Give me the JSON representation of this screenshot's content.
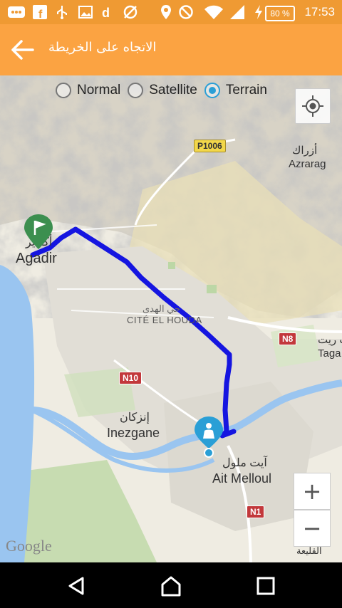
{
  "status_bar": {
    "battery": "80 %",
    "time": "17:53",
    "icons": [
      "messages-icon",
      "facebook-icon",
      "usb-icon",
      "image-icon",
      "d-app-icon",
      "no-sync-icon",
      "location-icon",
      "blocked-icon",
      "wifi-icon",
      "signal-icon",
      "charging-icon"
    ]
  },
  "app_bar": {
    "title": "الاتجاه على الخريطة",
    "back_icon": "arrow-back-icon"
  },
  "map_type": {
    "options": [
      "Normal",
      "Satellite",
      "Terrain"
    ],
    "selected": "Terrain"
  },
  "map": {
    "labels": {
      "azrarag_ar": "أزراك",
      "azrarag": "Azrarag",
      "agadir_ar": "أكادير",
      "agadir": "Agadir",
      "cite_ar": "حي الهدى",
      "cite": "CITÉ EL HOUDA",
      "inezgane_ar": "إنزكان",
      "inezgane": "Inezgane",
      "aitmelloul_ar": "آيت ملول",
      "aitmelloul": "Ait Melloul",
      "taga_ar": "ت ريت",
      "taga": "Taga",
      "qliaa_ar": "القليعة"
    },
    "roads": {
      "p1006": "P1006",
      "n8": "N8",
      "n10": "N10",
      "n1": "N1"
    },
    "logo": "Google",
    "accent_color": "#2a9fd6",
    "route_color": "#1515e0"
  },
  "zoom": {
    "in": "+",
    "out": "−"
  },
  "nav_bar": {
    "icons": [
      "back-nav-icon",
      "home-nav-icon",
      "recents-nav-icon"
    ]
  }
}
